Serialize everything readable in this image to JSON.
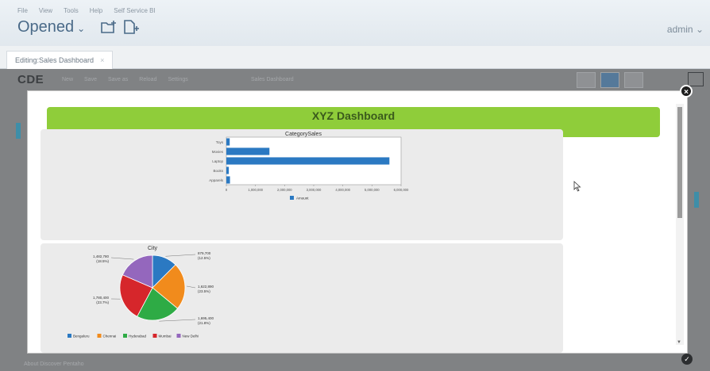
{
  "menu": [
    "File",
    "View",
    "Tools",
    "Help",
    "Self Service BI"
  ],
  "header": {
    "opened": "Opened",
    "user": "admin"
  },
  "tabs": [
    {
      "label": "Editing:Sales Dashboard",
      "close": "×"
    }
  ],
  "cde": {
    "logo": "CDE",
    "menu": [
      "New",
      "Save",
      "Save as",
      "Reload",
      "Settings"
    ],
    "title": "Sales Dashboard",
    "footer": "About     Discover Pentaho"
  },
  "dashboard": {
    "title": "XYZ Dashboard"
  },
  "colors": {
    "banner": "#8fcd3a",
    "bar": "#2b79c2",
    "accent": "#55799a"
  },
  "bar_chart_data": {
    "type": "bar",
    "orientation": "horizontal",
    "title": "CategorySales",
    "categories": [
      "Toys",
      "Movies",
      "Laptop",
      "Books",
      "Apparels"
    ],
    "values": [
      115000,
      1480000,
      5600000,
      85000,
      125000
    ],
    "x_ticks": [
      "0",
      "1,000,000",
      "2,000,000",
      "3,000,000",
      "4,000,000",
      "5,000,000",
      "6,000,000"
    ],
    "xlim": [
      0,
      6000000
    ],
    "legend": "Amount"
  },
  "pie_chart_data": {
    "type": "pie",
    "title": "City",
    "slices": [
      {
        "name": "Bengaluru",
        "value": 12.5,
        "color": "#2b79c2"
      },
      {
        "name": "Chennai",
        "value": 23.5,
        "color": "#f18b1c"
      },
      {
        "name": "Hyderabad",
        "value": 21.8,
        "color": "#2eab45"
      },
      {
        "name": "Mumbai",
        "value": 23.7,
        "color": "#d6262b"
      },
      {
        "name": "New Delhi",
        "value": 18.5,
        "color": "#9467bd"
      }
    ],
    "labels": [
      {
        "amount": "879,700",
        "pct": "(12.5%)"
      },
      {
        "amount": "1,622,890",
        "pct": "(23.5%)"
      },
      {
        "amount": "1,695,400",
        "pct": "(21.8%)"
      },
      {
        "amount": "1,780,400",
        "pct": "(23.7%)"
      },
      {
        "amount": "1,482,780",
        "pct": "(18.5%)"
      }
    ]
  }
}
